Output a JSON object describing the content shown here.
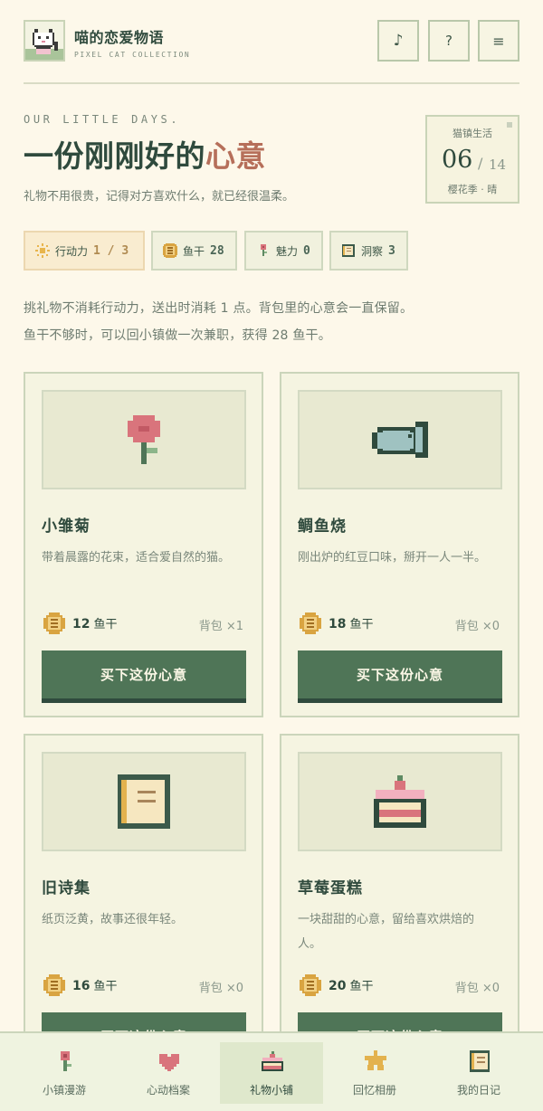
{
  "app": {
    "title": "喵的恋爱物语",
    "subtitle": "PIXEL CAT COLLECTION",
    "buttons": {
      "music": "♪",
      "help": "?",
      "menu": "≡"
    }
  },
  "intro": {
    "kicker": "OUR LITTLE DAYS.",
    "title_main": "一份刚刚好的",
    "title_accent": "心意",
    "subtitle": "礼物不用很贵，记得对方喜欢什么，就已经很温柔。"
  },
  "date": {
    "label": "猫镇生活",
    "day": "06",
    "slash": "/",
    "total": "14",
    "season": "樱花季 · 晴"
  },
  "stats": {
    "energy": {
      "label": "行动力",
      "value": "1 / 3",
      "icon": "sun-icon"
    },
    "fish": {
      "label": "鱼干",
      "value": "28",
      "icon": "coin-icon"
    },
    "charm": {
      "label": "魅力",
      "value": "0",
      "icon": "flower-icon"
    },
    "insight": {
      "label": "洞察",
      "value": "3",
      "icon": "book-icon"
    }
  },
  "notes": [
    "挑礼物不消耗行动力，送出时消耗 1 点。背包里的心意会一直保留。",
    "鱼干不够时，可以回小镇做一次兼职，获得 28 鱼干。"
  ],
  "gifts": [
    {
      "name": "小雏菊",
      "desc": "带着晨露的花束，适合爱自然的猫。",
      "price": "12",
      "currency": "鱼干",
      "bag": "背包 ×1",
      "button": "买下这份心意",
      "icon": "daisy-icon"
    },
    {
      "name": "鲷鱼烧",
      "desc": "刚出炉的红豆口味，掰开一人一半。",
      "price": "18",
      "currency": "鱼干",
      "bag": "背包 ×0",
      "button": "买下这份心意",
      "icon": "taiyaki-icon"
    },
    {
      "name": "旧诗集",
      "desc": "纸页泛黄，故事还很年轻。",
      "price": "16",
      "currency": "鱼干",
      "bag": "背包 ×0",
      "button": "买下这份心意",
      "icon": "poetry-book-icon"
    },
    {
      "name": "草莓蛋糕",
      "desc": "一块甜甜的心意，留给喜欢烘焙的人。",
      "price": "20",
      "currency": "鱼干",
      "bag": "背包 ×0",
      "button": "买下这份心意",
      "icon": "strawberry-cake-icon"
    }
  ],
  "nav": [
    {
      "label": "小镇漫游",
      "icon": "flower-icon"
    },
    {
      "label": "心动档案",
      "icon": "heart-icon"
    },
    {
      "label": "礼物小铺",
      "icon": "cake-icon",
      "active": true
    },
    {
      "label": "回忆相册",
      "icon": "star-icon"
    },
    {
      "label": "我的日记",
      "icon": "diary-icon"
    }
  ],
  "colors": {
    "background": "#fdf8ea",
    "primary": "#4f7557",
    "text": "#2f4a3d",
    "accent": "#b66f5a"
  }
}
